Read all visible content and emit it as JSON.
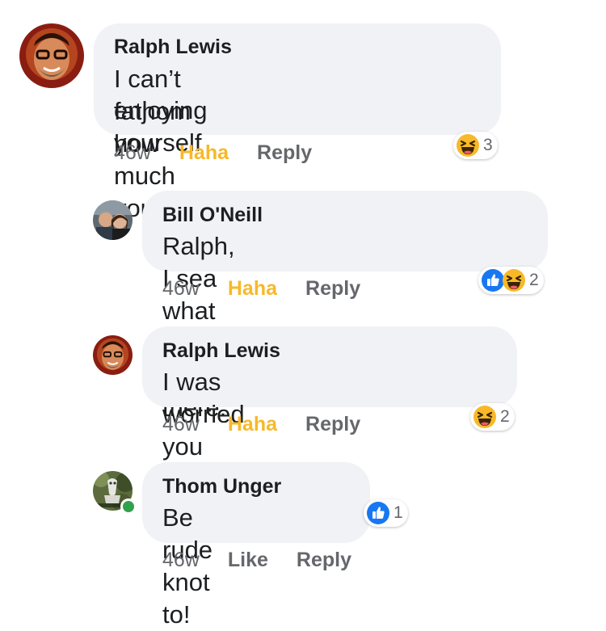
{
  "comments": [
    {
      "author": "Ralph Lewis",
      "text_line1": "I can’t fathom how much you’re",
      "text_line2": "enjoying yourself",
      "time": "46w",
      "reaction_label": "Haha",
      "reply_label": "Reply",
      "reaction_count": "3",
      "reaction_icons": [
        "haha-icon"
      ]
    },
    {
      "author": "Bill O'Neill",
      "text": "Ralph, I sea what you did there.",
      "time": "46w",
      "reaction_label": "Haha",
      "reply_label": "Reply",
      "reaction_count": "2",
      "reaction_icons": [
        "like-icon",
        "haha-icon"
      ]
    },
    {
      "author": "Ralph Lewis",
      "text": "I was worried you might knot",
      "time": "46w",
      "reaction_label": "Haha",
      "reply_label": "Reply",
      "reaction_count": "2",
      "reaction_icons": [
        "haha-icon"
      ]
    },
    {
      "author": "Thom Unger",
      "text": "Be rude knot to!",
      "time": "46w",
      "reaction_label": "Like",
      "reply_label": "Reply",
      "reaction_count": "1",
      "reaction_icons": [
        "like-icon"
      ],
      "online": true
    }
  ],
  "colors": {
    "bubble": "#f0f2f5",
    "haha_accent": "#f7b928",
    "like_blue": "#1877f2",
    "meta_gray": "#65676b",
    "online_green": "#31a24c"
  }
}
